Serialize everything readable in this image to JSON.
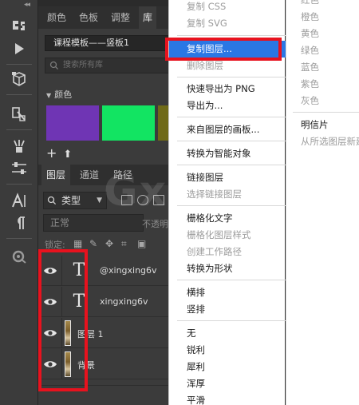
{
  "tools": {
    "collapse_glyph": "◂◂",
    "items": [
      "history-brush-icon",
      "play-icon",
      "3d-cube-icon",
      "measure-icon",
      "brush-settings-icon",
      "adjustments-icon",
      "paragraph-text-icon",
      "pilcrow-icon",
      "properties-icon"
    ]
  },
  "panel": {
    "tabs": [
      "颜色",
      "色板",
      "调整",
      "库"
    ],
    "active_tab": "库",
    "library_name": "课程模板——竖板1",
    "search_placeholder": "搜索所有库",
    "colors_section": "颜色",
    "swatches": [
      "#6f35b4",
      "#12e462",
      "#6f6a18"
    ],
    "add_glyph": "+",
    "upload_glyph": "⬆"
  },
  "layers_panel": {
    "tabs": [
      "图层",
      "通道",
      "路径"
    ],
    "active_tab": "图层",
    "filter_label": "类型",
    "blend_mode": "正常",
    "opacity_label": "不透明",
    "lock_label": "锁定:",
    "layers": [
      {
        "name": "@xingxing6v",
        "kind": "text",
        "type_glyph": "T"
      },
      {
        "name": "xingxing6v",
        "kind": "text",
        "type_glyph": "T"
      },
      {
        "name": "图层 1",
        "kind": "image"
      },
      {
        "name": "背景",
        "kind": "image"
      }
    ]
  },
  "watermark": "Gx",
  "context_menu": {
    "items": [
      {
        "label": "复制 CSS",
        "disabled": true
      },
      {
        "label": "复制 SVG",
        "disabled": true
      },
      {
        "label": "复制图层...",
        "disabled": false,
        "highlight": true
      },
      {
        "label": "删除图层",
        "disabled": true
      },
      {
        "label": "快速导出为 PNG",
        "disabled": false
      },
      {
        "label": "导出为...",
        "disabled": false
      },
      {
        "label": "来自图层的画板...",
        "disabled": false
      },
      {
        "label": "转换为智能对象",
        "disabled": false
      },
      {
        "label": "链接图层",
        "disabled": false
      },
      {
        "label": "选择链接图层",
        "disabled": true
      },
      {
        "label": "栅格化文字",
        "disabled": false
      },
      {
        "label": "栅格化图层样式",
        "disabled": true
      },
      {
        "label": "创建工作路径",
        "disabled": true
      },
      {
        "label": "转换为形状",
        "disabled": false
      },
      {
        "label": "横排",
        "disabled": false
      },
      {
        "label": "竖排",
        "disabled": false
      },
      {
        "label": "无",
        "disabled": false
      },
      {
        "label": "锐利",
        "disabled": false
      },
      {
        "label": "犀利",
        "disabled": false
      },
      {
        "label": "浑厚",
        "disabled": false
      },
      {
        "label": "平滑",
        "disabled": false
      }
    ]
  },
  "submenu": {
    "items": [
      {
        "label": "红色",
        "disabled": true
      },
      {
        "label": "橙色",
        "disabled": true
      },
      {
        "label": "黄色",
        "disabled": true
      },
      {
        "label": "绿色",
        "disabled": true
      },
      {
        "label": "蓝色",
        "disabled": true
      },
      {
        "label": "紫色",
        "disabled": true
      },
      {
        "label": "灰色",
        "disabled": true
      },
      {
        "label": "明信片",
        "disabled": false
      },
      {
        "label": "从所选图层新建",
        "disabled": true
      }
    ]
  }
}
